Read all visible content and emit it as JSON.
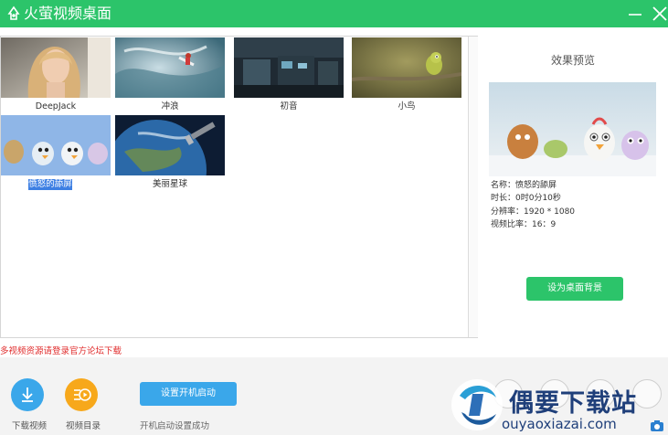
{
  "app": {
    "title": "火萤视频桌面"
  },
  "gallery": {
    "items": [
      {
        "caption": "DeepJack"
      },
      {
        "caption": "冲浪"
      },
      {
        "caption": "初音"
      },
      {
        "caption": "小鸟"
      },
      {
        "caption": "愤怒的舔屏"
      },
      {
        "caption": "美丽星球"
      }
    ],
    "selected_index": 4
  },
  "preview": {
    "title": "效果预览",
    "name": "名称：愤怒的舔屏",
    "duration": "时长：0时0分10秒",
    "resolution": "分辨率：1920 * 1080",
    "ratio": "视频比率：16：9",
    "set_bg_label": "设为桌面背景"
  },
  "notice": "多视频资源请登录官方论坛下载",
  "bottom": {
    "download_label": "下载视频",
    "catalog_label": "视频目录",
    "startup_button": "设置开机启动",
    "startup_status": "开机启动设置成功"
  },
  "watermark": {
    "brand": "偶要下载站",
    "url": "ouyaoxiazai.com"
  },
  "colors": {
    "accent_green": "#2cc46a",
    "accent_blue": "#3aa7ea",
    "accent_orange": "#f7a81b",
    "notice_red": "#e02b2b",
    "selection_blue": "#3d7fe3"
  }
}
